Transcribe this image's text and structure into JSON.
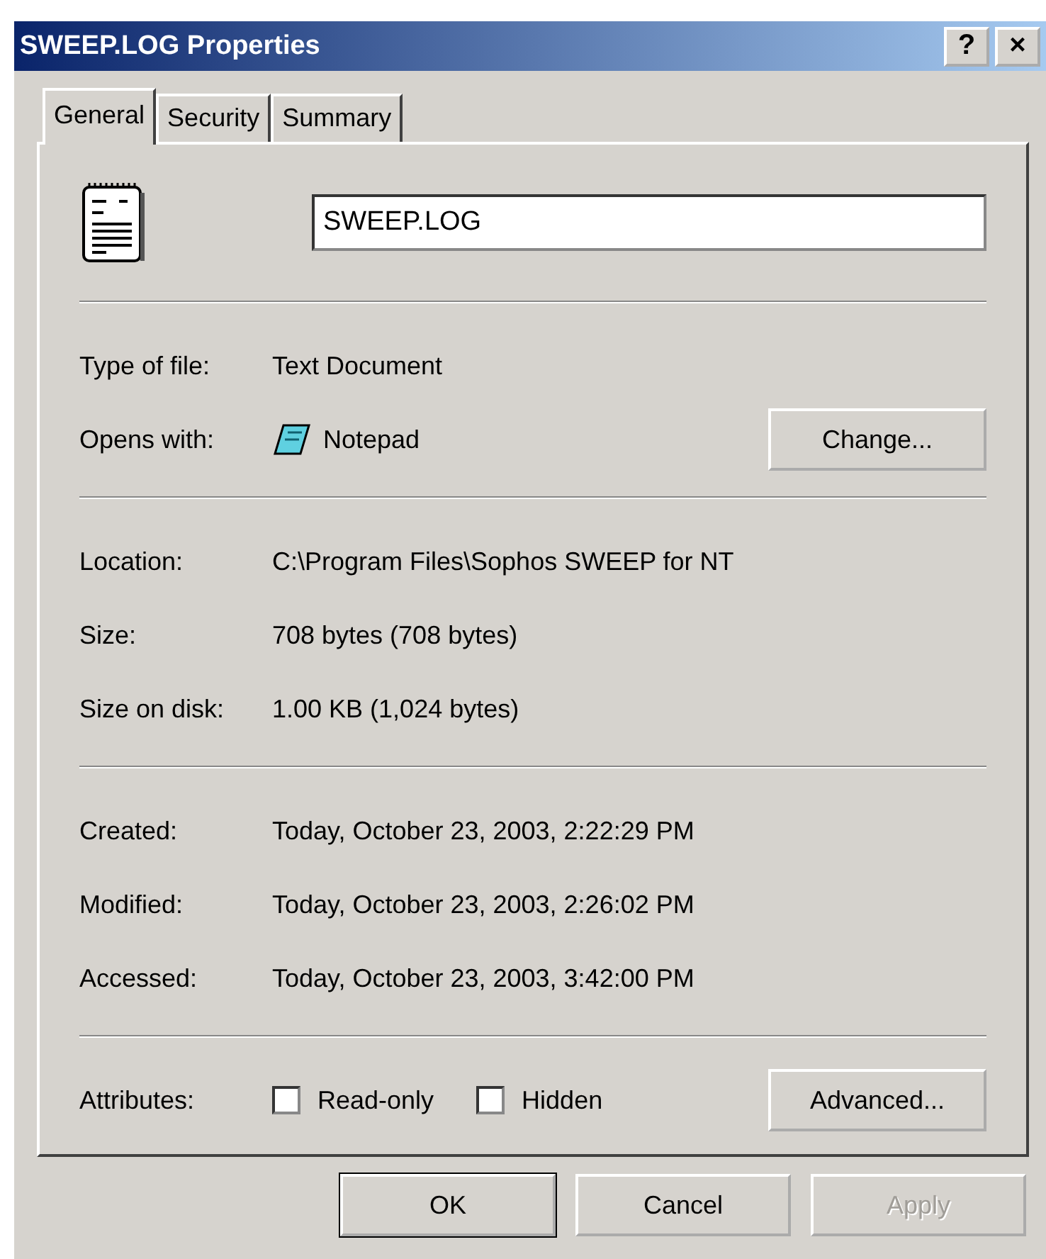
{
  "window": {
    "title": "SWEEP.LOG Properties",
    "help_button": "?",
    "close_button": "×"
  },
  "tabs": [
    {
      "label": "General",
      "selected": true
    },
    {
      "label": "Security",
      "selected": false
    },
    {
      "label": "Summary",
      "selected": false
    }
  ],
  "file_name": "SWEEP.LOG",
  "sections": [
    {
      "rows": [
        {
          "kind": "text",
          "label": "Type of file:",
          "value": "Text Document"
        },
        {
          "kind": "app",
          "label": "Opens with:",
          "value": "Notepad",
          "button": "Change..."
        }
      ]
    },
    {
      "rows": [
        {
          "kind": "text",
          "label": "Location:",
          "value": "C:\\Program Files\\Sophos SWEEP for NT"
        },
        {
          "kind": "text",
          "label": "Size:",
          "value": "708 bytes (708 bytes)"
        },
        {
          "kind": "text",
          "label": "Size on disk:",
          "value": "1.00 KB (1,024 bytes)"
        }
      ]
    },
    {
      "rows": [
        {
          "kind": "text",
          "label": "Created:",
          "value": "Today, October 23, 2003, 2:22:29 PM"
        },
        {
          "kind": "text",
          "label": "Modified:",
          "value": "Today, October 23, 2003, 2:26:02 PM"
        },
        {
          "kind": "text",
          "label": "Accessed:",
          "value": "Today, October 23, 2003, 3:42:00 PM"
        }
      ]
    },
    {
      "rows": [
        {
          "kind": "attributes",
          "label": "Attributes:",
          "checkboxes": [
            {
              "label": "Read-only",
              "checked": false
            },
            {
              "label": "Hidden",
              "checked": false
            }
          ],
          "button": "Advanced..."
        }
      ]
    }
  ],
  "buttons": [
    {
      "label": "OK",
      "default": true,
      "disabled": false
    },
    {
      "label": "Cancel",
      "default": false,
      "disabled": false
    },
    {
      "label": "Apply",
      "default": false,
      "disabled": true
    }
  ]
}
